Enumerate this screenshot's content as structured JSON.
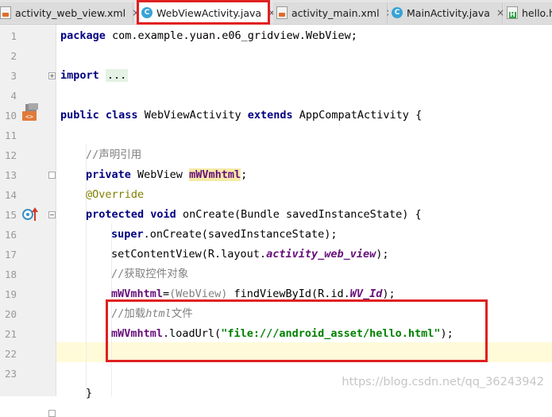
{
  "tabs": [
    {
      "label": "activity_web_view.xml",
      "icon": "xml-file-icon",
      "active": false
    },
    {
      "label": "WebViewActivity.java",
      "icon": "java-class-icon",
      "active": true
    },
    {
      "label": "activity_main.xml",
      "icon": "xml-file-icon",
      "active": false
    },
    {
      "label": "MainActivity.java",
      "icon": "java-class-icon",
      "active": false
    },
    {
      "label": "hello.h",
      "icon": "html-file-icon",
      "active": false
    }
  ],
  "tab_close_glyph": "×",
  "line_numbers": [
    "1",
    "2",
    "3",
    "4",
    "10",
    "11",
    "12",
    "13",
    "14",
    "15",
    "16",
    "17",
    "18",
    "19",
    "20",
    "21",
    "22",
    "23"
  ],
  "code": {
    "l1": {
      "kw": "package",
      "rest": " com.example.yuan.e06_gridview.WebView;"
    },
    "l3": {
      "kw": "import",
      "fold": "..."
    },
    "l10": {
      "kw1": "public",
      "kw2": "class",
      "name": " WebViewActivity ",
      "kw3": "extends",
      "rest": " AppCompatActivity {"
    },
    "l12": {
      "comment": "//声明引用"
    },
    "l13": {
      "kw": "private",
      "type": " WebView ",
      "field": "mWVmhtml",
      "end": ";"
    },
    "l14": {
      "annotation": "@Override"
    },
    "l15": {
      "kw1": "protected",
      "kw2": "void",
      "rest": " onCreate(Bundle savedInstanceState) {"
    },
    "l16": {
      "kw": "super",
      "rest": ".onCreate(savedInstanceState);"
    },
    "l17": {
      "pre": "setContentView(R.layout.",
      "sfield": "activity_web_view",
      "end": ");"
    },
    "l18": {
      "comment": "//获取控件对象"
    },
    "l19": {
      "field": "mWVmhtml",
      "eq": "=",
      "cast": "(WebView)",
      "pre": " findViewById(R.id.",
      "sfield": "WV_Id",
      "end": ");"
    },
    "l20": {
      "c1": "//加载",
      "c2": "html",
      "c3": "文件"
    },
    "l21": {
      "field": "mWVmhtml",
      "pre": ".loadUrl(",
      "str": "\"file:///android_asset/hello.html\"",
      "end": ");"
    },
    "l23": {
      "brace": "}"
    }
  },
  "gutter_icons": {
    "line10": "android-activity-icon",
    "line15": "override-method-icon"
  },
  "watermark": "https://blog.csdn.net/qq_36243942",
  "colors": {
    "highlight_box": "#e02020",
    "keyword": "#000080",
    "field": "#660e7a",
    "string": "#008000",
    "comment": "#808080",
    "annotation": "#808000",
    "current_line": "#fffbd9"
  }
}
